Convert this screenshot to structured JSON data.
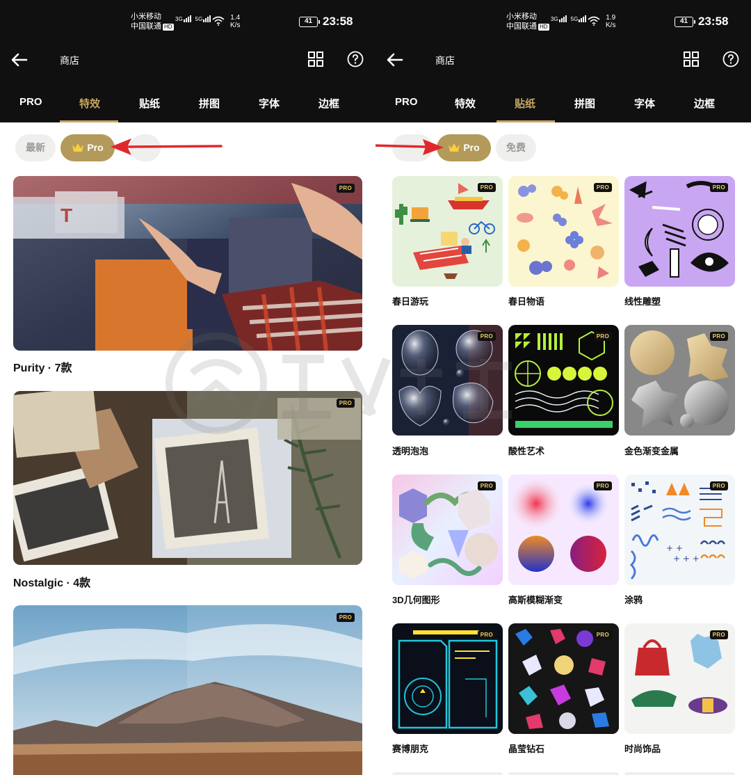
{
  "left": {
    "status": {
      "carrier1": "小米移动",
      "carrier2": "中国联通",
      "hd": "HD",
      "net1": "3G",
      "net2": "5G",
      "speed_val": "1.4",
      "speed_unit": "K/s",
      "battery": "41",
      "time": "23:58"
    },
    "title": "商店",
    "tabs": [
      "PRO",
      "特效",
      "贴纸",
      "拼图",
      "字体",
      "边框"
    ],
    "active_tab_index": 1,
    "chips": {
      "latest": "最新",
      "pro": "Pro"
    },
    "cards": [
      {
        "title": "Purity · 7款",
        "badge": "PRO"
      },
      {
        "title": "Nostalgic · 4款",
        "badge": "PRO"
      },
      {
        "title": "",
        "badge": "PRO"
      }
    ]
  },
  "right": {
    "status": {
      "carrier1": "小米移动",
      "carrier2": "中国联通",
      "hd": "HD",
      "net1": "3G",
      "net2": "5G",
      "speed_val": "1.9",
      "speed_unit": "K/s",
      "battery": "41",
      "time": "23:58"
    },
    "title": "商店",
    "tabs": [
      "PRO",
      "特效",
      "贴纸",
      "拼图",
      "字体",
      "边框"
    ],
    "active_tab_index": 2,
    "chips": {
      "pro": "Pro",
      "free": "免费"
    },
    "tiles": [
      {
        "label": "春日游玩",
        "badge": "PRO"
      },
      {
        "label": "春日物语",
        "badge": "PRO"
      },
      {
        "label": "线性雕塑",
        "badge": "PRO"
      },
      {
        "label": "透明泡泡",
        "badge": "PRO"
      },
      {
        "label": "酸性艺术",
        "badge": "PRO"
      },
      {
        "label": "金色渐变金属",
        "badge": "PRO"
      },
      {
        "label": "3D几何图形",
        "badge": "PRO"
      },
      {
        "label": "高斯模糊渐变",
        "badge": "PRO"
      },
      {
        "label": "涂鸦",
        "badge": "PRO"
      },
      {
        "label": "赛博朋克",
        "badge": "PRO"
      },
      {
        "label": "晶莹钻石",
        "badge": "PRO"
      },
      {
        "label": "时尚饰品",
        "badge": "PRO"
      }
    ]
  },
  "colors": {
    "header_bg": "#101010",
    "accent_gold": "#c7a560",
    "pro_chip": "#b39a5a",
    "arrow_red": "#e0282c"
  }
}
